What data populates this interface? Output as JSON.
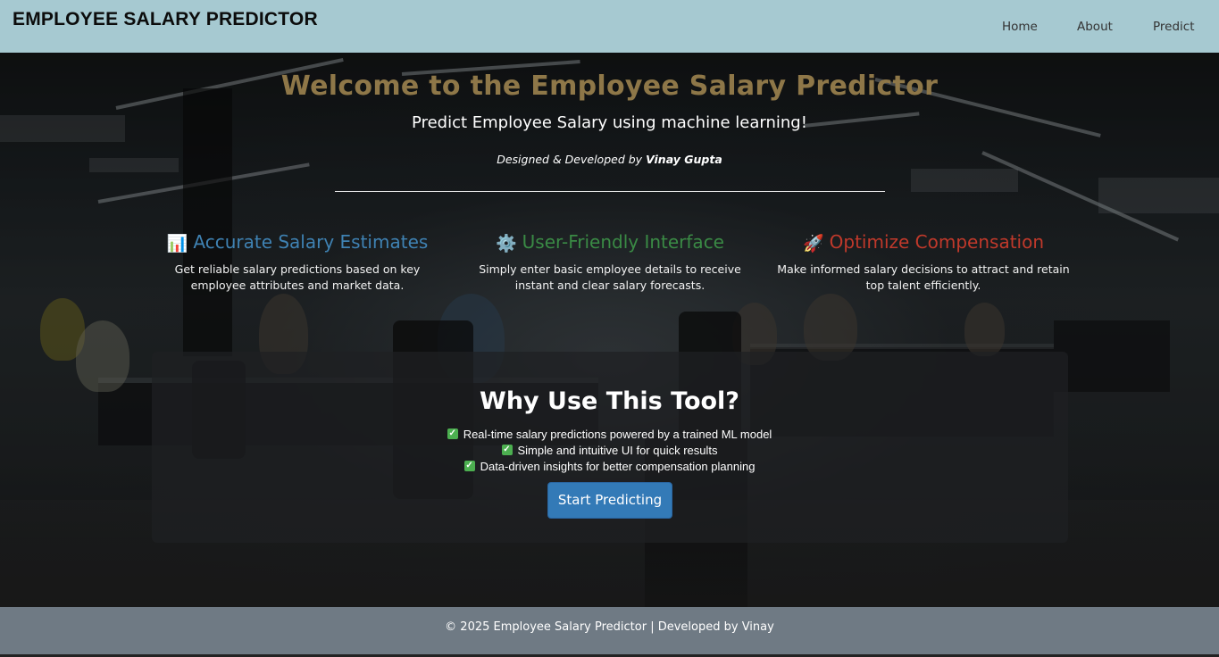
{
  "header": {
    "brand": "EMPLOYEE SALARY PREDICTOR",
    "nav": [
      {
        "label": "Home"
      },
      {
        "label": "About"
      },
      {
        "label": "Predict"
      }
    ]
  },
  "hero": {
    "title": "Welcome to the Employee Salary Predictor",
    "subtitle": "Predict Employee Salary using machine learning!",
    "credit_prefix": "Designed & Developed by",
    "credit_name": "Vinay Gupta"
  },
  "features": [
    {
      "icon": "bar-chart-icon",
      "glyph": "📊",
      "title": "Accurate Salary Estimates",
      "color": "#3f82b3",
      "description": "Get reliable salary predictions based on key employee attributes and market data."
    },
    {
      "icon": "gear-icon",
      "glyph": "⚙️",
      "title": "User-Friendly Interface",
      "color": "#3a8a45",
      "description": "Simply enter basic employee details to receive instant and clear salary forecasts."
    },
    {
      "icon": "rocket-icon",
      "glyph": "🚀",
      "title": "Optimize Compensation",
      "color": "#c0392b",
      "description": "Make informed salary decisions to attract and retain top talent efficiently."
    }
  ],
  "why": {
    "heading": "Why Use This Tool?",
    "points": [
      "Real-time salary predictions powered by a trained ML model",
      "Simple and intuitive UI for quick results",
      "Data-driven insights for better compensation planning"
    ],
    "check_glyph": "✓",
    "cta_label": "Start Predicting"
  },
  "footer": {
    "text": "© 2025 Employee Salary Predictor | Developed by Vinay"
  }
}
